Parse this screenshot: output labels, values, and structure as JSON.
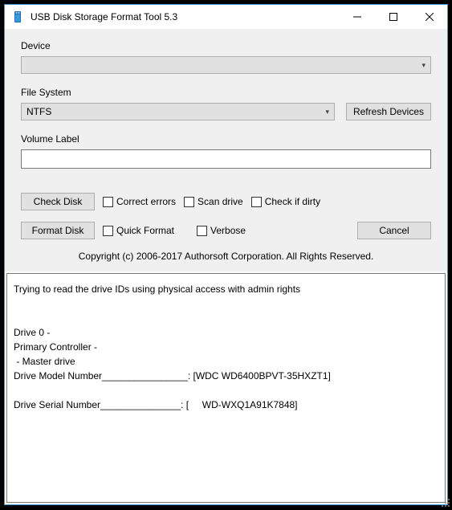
{
  "window": {
    "title": "USB Disk Storage Format Tool 5.3"
  },
  "labels": {
    "device": "Device",
    "file_system": "File System",
    "volume_label": "Volume Label"
  },
  "device": {
    "selected": ""
  },
  "file_system": {
    "selected": "NTFS"
  },
  "buttons": {
    "refresh": "Refresh Devices",
    "check_disk": "Check Disk",
    "format_disk": "Format Disk",
    "cancel": "Cancel"
  },
  "volume": {
    "value": ""
  },
  "checkboxes": {
    "correct_errors": "Correct errors",
    "scan_drive": "Scan drive",
    "check_if_dirty": "Check if dirty",
    "quick_format": "Quick Format",
    "verbose": "Verbose"
  },
  "copyright": "Copyright (c) 2006-2017 Authorsoft Corporation. All Rights Reserved.",
  "log": "Trying to read the drive IDs using physical access with admin rights\n\n\nDrive 0 - \nPrimary Controller - \n - Master drive\nDrive Model Number________________: [WDC WD6400BPVT-35HXZT1]\n\nDrive Serial Number_______________: [     WD-WXQ1A91K7848]"
}
